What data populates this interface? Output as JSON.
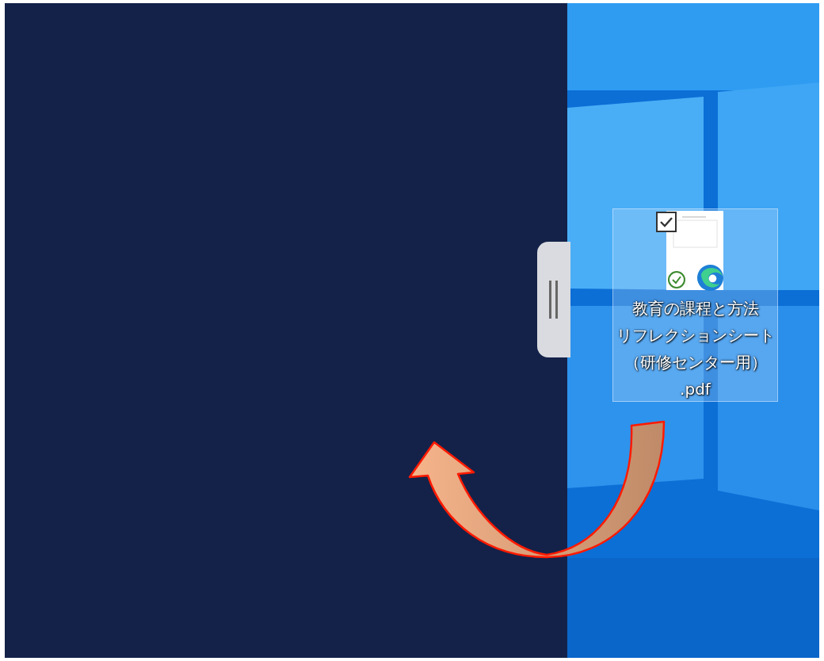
{
  "desktop": {
    "icons": [
      {
        "name_lines": [
          "教育の課程と方法",
          "リフレクションシート",
          "（研修センター用）",
          ".pdf"
        ],
        "selected": true,
        "checked": true
      }
    ]
  }
}
